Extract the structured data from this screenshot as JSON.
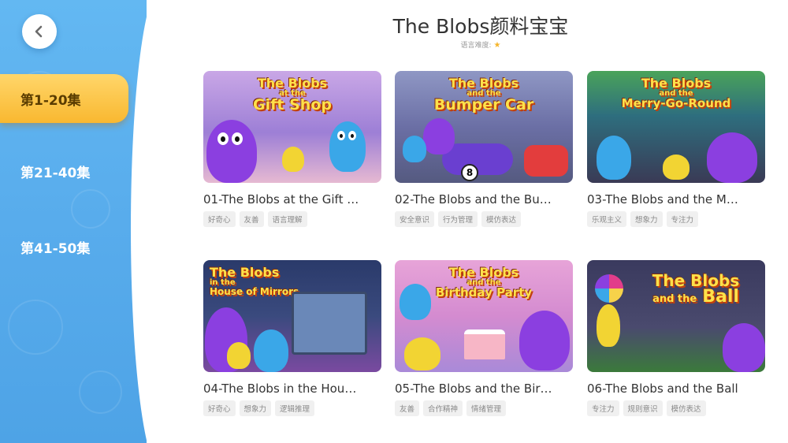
{
  "header": {
    "title": "The Blobs颜料宝宝",
    "difficulty_label": "语言难度:",
    "difficulty_stars": 1
  },
  "sidebar": {
    "back_icon": "chevron-left-icon",
    "items": [
      {
        "label": "第1-20集",
        "active": true
      },
      {
        "label": "第21-40集",
        "active": false
      },
      {
        "label": "第41-50集",
        "active": false
      }
    ]
  },
  "episodes": [
    {
      "title": "01-The Blobs at the Gift Shop",
      "display_title": "01-The Blobs at the Gift …",
      "thumb_text": [
        "The Blobs",
        "at the",
        "Gift Shop"
      ],
      "tags": [
        "好奇心",
        "友善",
        "语言理解"
      ]
    },
    {
      "title": "02-The Blobs and the Bumper Car",
      "display_title": "02-The Blobs and the Bu…",
      "thumb_text": [
        "The Blobs",
        "and the",
        "Bumper Car"
      ],
      "tags": [
        "安全意识",
        "行为管理",
        "模仿表达"
      ]
    },
    {
      "title": "03-The Blobs and the Merry-Go-Round",
      "display_title": "03-The Blobs and the M…",
      "thumb_text": [
        "The Blobs",
        "and the",
        "Merry-Go-Round"
      ],
      "tags": [
        "乐观主义",
        "想象力",
        "专注力"
      ]
    },
    {
      "title": "04-The Blobs in the House of Mirrors",
      "display_title": "04-The Blobs in the Hou…",
      "thumb_text": [
        "The Blobs",
        "in the",
        "House of Mirrors"
      ],
      "tags": [
        "好奇心",
        "想象力",
        "逻辑推理"
      ]
    },
    {
      "title": "05-The Blobs and the Birthday Party",
      "display_title": "05-The Blobs and the Bir…",
      "thumb_text": [
        "The Blobs",
        "and the",
        "Birthday Party"
      ],
      "tags": [
        "友善",
        "合作精神",
        "情绪管理"
      ]
    },
    {
      "title": "06-The Blobs and the Ball",
      "display_title": "06-The Blobs and the Ball",
      "thumb_text": [
        "The Blobs",
        "and the",
        "Ball"
      ],
      "tags": [
        "专注力",
        "规则意识",
        "模仿表达"
      ]
    }
  ],
  "colors": {
    "sidebar": "#58acec",
    "active_tab": "#f9b830",
    "star": "#f5b52b",
    "title_text": "#333333"
  }
}
